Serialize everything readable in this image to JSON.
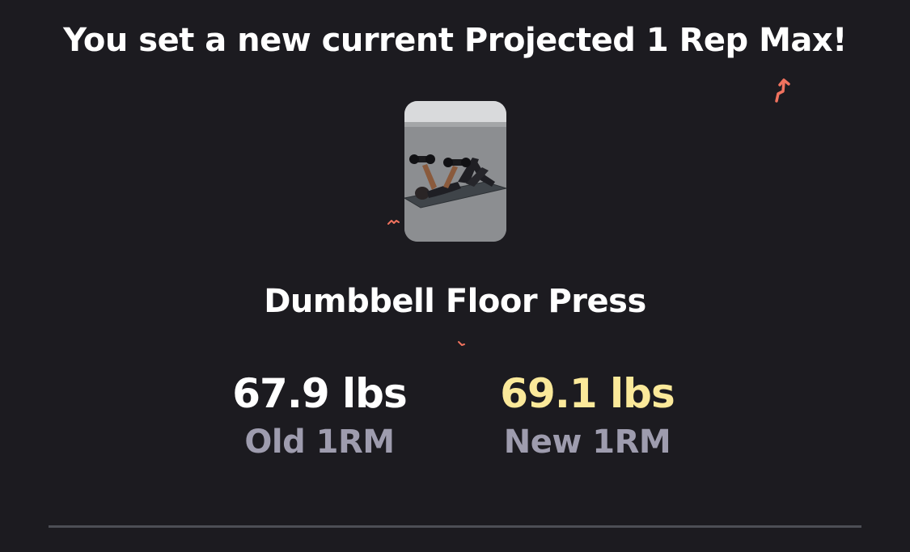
{
  "headline": "You set a new current Projected 1 Rep Max!",
  "exercise": {
    "name": "Dumbbell Floor Press",
    "image_alt": "Person lying on mat pressing two dumbbells"
  },
  "stats": {
    "old": {
      "value": "67.9 lbs",
      "label": "Old 1RM"
    },
    "new": {
      "value": "69.1 lbs",
      "label": "New 1RM"
    }
  },
  "colors": {
    "background": "#1c1b20",
    "old_value": "#ffffff",
    "new_value": "#fbe99a",
    "label": "#9e9cae",
    "confetti": "#f0725e",
    "divider": "#4c4e55"
  }
}
